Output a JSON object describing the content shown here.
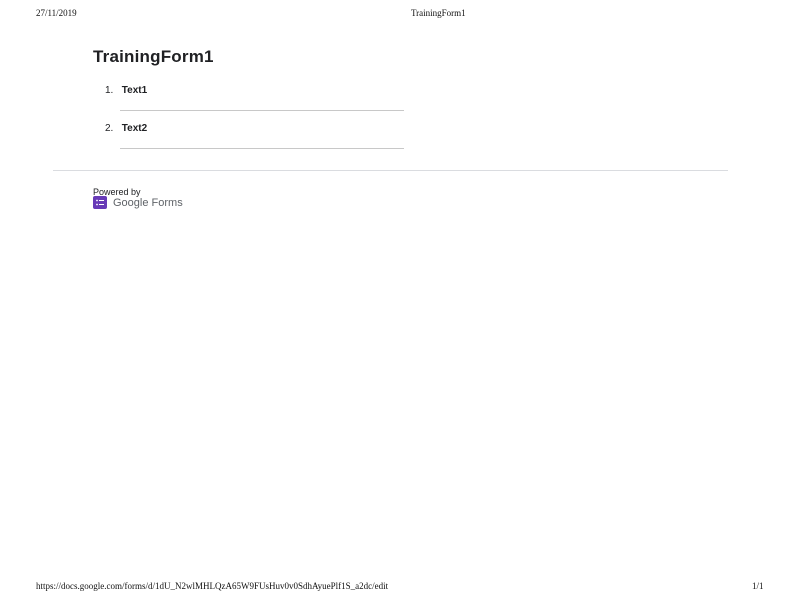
{
  "print_header": {
    "date": "27/11/2019",
    "title": "TrainingForm1"
  },
  "form": {
    "title": "TrainingForm1",
    "questions": [
      {
        "number": "1.",
        "label": "Text1"
      },
      {
        "number": "2.",
        "label": "Text2"
      }
    ]
  },
  "branding": {
    "powered_by": "Powered by",
    "product": "Google Forms",
    "icon": "google-forms-icon",
    "icon_color": "#673ab7"
  },
  "print_footer": {
    "url": "https://docs.google.com/forms/d/1dU_N2wlMHLQzA65W9FUsHuv0v0SdhAyuePlf1S_a2dc/edit",
    "page": "1/1"
  }
}
